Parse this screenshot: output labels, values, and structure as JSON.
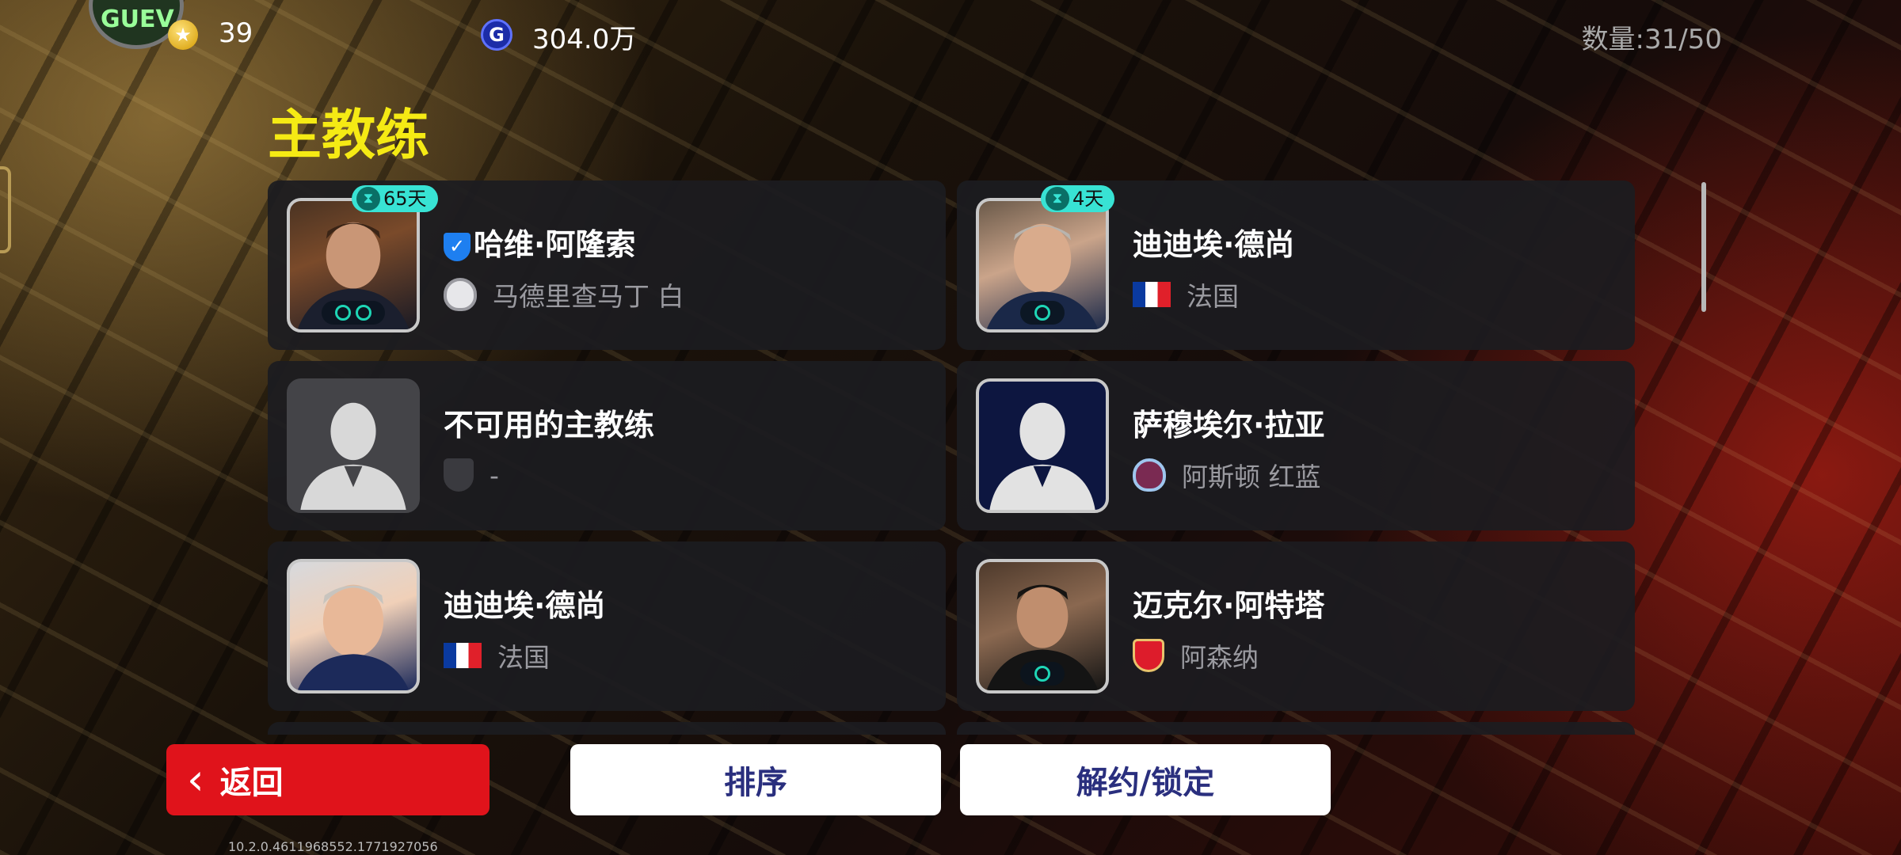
{
  "topbar": {
    "coins": "39",
    "gp": "304.0万",
    "gp_icon_letter": "G",
    "count": "数量:31/50",
    "avatar_text": "GUEV"
  },
  "section_title": "主教练",
  "coaches": [
    {
      "name": "哈维·阿隆索",
      "verified": true,
      "days": "65天",
      "team": "马德里查马丁 白",
      "crest": "madrid-crest-icon",
      "portrait": "photo"
    },
    {
      "name": "迪迪埃·德尚",
      "verified": false,
      "days": "4天",
      "team": "法国",
      "crest": "france-flag-icon",
      "portrait": "photo"
    },
    {
      "name": "不可用的主教练",
      "verified": false,
      "days": "",
      "team": "-",
      "crest": "shield-icon",
      "portrait": "placeholder"
    },
    {
      "name": "萨穆埃尔·拉亚",
      "verified": false,
      "days": "",
      "team": "阿斯顿 红蓝",
      "crest": "aston-crest-icon",
      "portrait": "placeholder"
    },
    {
      "name": "迪迪埃·德尚",
      "verified": false,
      "days": "",
      "team": "法国",
      "crest": "france-flag-icon",
      "portrait": "photo"
    },
    {
      "name": "迈克尔·阿特塔",
      "verified": false,
      "days": "",
      "team": "阿森纳",
      "crest": "arsenal-crest-icon",
      "portrait": "photo"
    }
  ],
  "buttons": {
    "back": "返回",
    "sort": "排序",
    "release_lock": "解约/锁定"
  },
  "version": "10.2.0.4611968552.1771927056",
  "colors": {
    "title_yellow": "#f5ea14",
    "back_red": "#e0131b",
    "button_text": "#2a2f7e",
    "days_badge": "#38e3d4"
  }
}
